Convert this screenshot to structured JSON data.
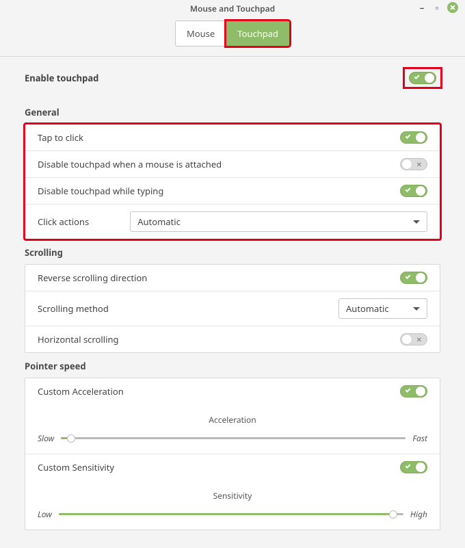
{
  "window": {
    "title": "Mouse and Touchpad"
  },
  "tabs": {
    "mouse": "Mouse",
    "touchpad": "Touchpad"
  },
  "enable": {
    "label": "Enable touchpad",
    "value": true
  },
  "general": {
    "title": "General",
    "tap_to_click": {
      "label": "Tap to click",
      "value": true
    },
    "disable_when_mouse": {
      "label": "Disable touchpad when a mouse is attached",
      "value": false
    },
    "disable_while_typing": {
      "label": "Disable touchpad while typing",
      "value": true
    },
    "click_actions": {
      "label": "Click actions",
      "value": "Automatic"
    }
  },
  "scrolling": {
    "title": "Scrolling",
    "reverse": {
      "label": "Reverse scrolling direction",
      "value": true
    },
    "method": {
      "label": "Scrolling method",
      "value": "Automatic"
    },
    "horizontal": {
      "label": "Horizontal scrolling",
      "value": false
    }
  },
  "pointer": {
    "title": "Pointer speed",
    "accel": {
      "label": "Custom Acceleration",
      "value": true
    },
    "accel_slider": {
      "label": "Acceleration",
      "low_label": "Slow",
      "high_label": "Fast",
      "value_pct": 3
    },
    "sens": {
      "label": "Custom Sensitivity",
      "value": true
    },
    "sens_slider": {
      "label": "Sensitivity",
      "low_label": "Low",
      "high_label": "High",
      "value_pct": 97
    }
  },
  "colors": {
    "accent": "#8fbc69",
    "highlight": "#e3001b"
  }
}
